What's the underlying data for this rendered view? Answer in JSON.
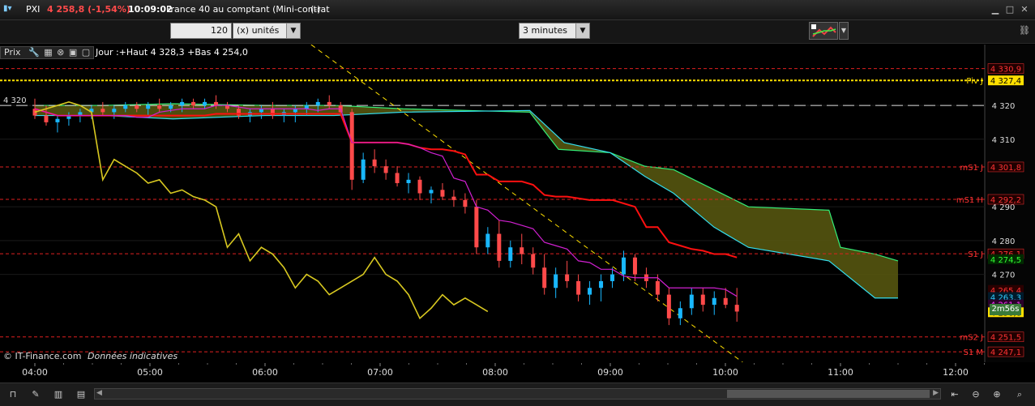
{
  "titlebar": {
    "symbol": "PXI",
    "price_change": "4 258,8 (-1,54%)",
    "time": "10:09:02",
    "name": "France 40 au comptant (Mini-contrat",
    "flag": "(-)",
    "colors": {
      "down": "#ff4a4a"
    }
  },
  "toolbar": {
    "units_value": "120",
    "units_label": "(x) unités",
    "interval": "3 minutes"
  },
  "panel": {
    "label": "Prix",
    "info": "Jour :+Haut 4 328,3 +Bas 4 254,0",
    "watermark": "© IT-Finance.com",
    "watermark_note": "Données indicatives",
    "timer": "2m56s"
  },
  "chart_data": {
    "type": "candlestick",
    "x_ticks": [
      "04:00",
      "05:00",
      "06:00",
      "07:00",
      "08:00",
      "09:00",
      "10:00",
      "11:00",
      "12:00"
    ],
    "y_ticks": [
      "4 320",
      "4 310",
      "4 290",
      "4 280",
      "4 270"
    ],
    "y_left_label": "4 320",
    "ylim": [
      4244,
      4338
    ],
    "levels": [
      {
        "name": "Piv J",
        "value": 4327.4,
        "label": "4 327,4",
        "color": "#ffe000",
        "style": "dotted-bold",
        "box": "#ffe000",
        "text_color": "#000"
      },
      {
        "name": "",
        "value": 4330.9,
        "label": "4 330,9",
        "color": "#e02020",
        "style": "dashed",
        "box": "#200000",
        "text_color": "#ff3333"
      },
      {
        "name": "mS1 J",
        "value": 4301.8,
        "label": "4 301,8",
        "color": "#e02020",
        "style": "dashed",
        "box": "#200000",
        "text_color": "#ff3333"
      },
      {
        "name": "mS1 H",
        "value": 4292.2,
        "label": "4 292,2",
        "color": "#e02020",
        "style": "dashed",
        "box": "#200000",
        "text_color": "#ff3333"
      },
      {
        "name": "S1 J",
        "value": 4276.1,
        "label": "4 276,1",
        "color": "#e02020",
        "style": "dashed",
        "box": "#200000",
        "text_color": "#ff3333"
      },
      {
        "name": "mS2 J",
        "value": 4251.5,
        "label": "4 251,5",
        "color": "#e02020",
        "style": "dashed",
        "box": "#200000",
        "text_color": "#ff3333"
      },
      {
        "name": "S1 M",
        "value": 4247.1,
        "label": "4 247,1",
        "color": "#e02020",
        "style": "dashed",
        "box": "#200000",
        "text_color": "#ff3333"
      },
      {
        "name": "",
        "value": 4320.0,
        "label": "",
        "color": "#dddddd",
        "style": "long-dash",
        "box": "",
        "text_color": ""
      }
    ],
    "price_boxes": [
      {
        "value": 4274.5,
        "label": "4 274,5",
        "bg": "#002a00",
        "color": "#33ff33"
      },
      {
        "value": 4265.4,
        "label": "4 265,4",
        "bg": "#2a0000",
        "color": "#ff3333"
      },
      {
        "value": 4263.3,
        "label": "4 263,3",
        "bg": "#001a2a",
        "color": "#33ccff"
      },
      {
        "value": 4261.1,
        "label": "4 261,1",
        "bg": "#2a002a",
        "color": "#ff33ff"
      },
      {
        "value": 4258.8,
        "label": "4 258,8",
        "bg": "#ffe000",
        "color": "#000000"
      }
    ],
    "candles": [
      [
        4319,
        4322,
        4316,
        4317
      ],
      [
        4317,
        4320,
        4314,
        4315
      ],
      [
        4315,
        4317,
        4312,
        4316
      ],
      [
        4316,
        4318,
        4314,
        4317
      ],
      [
        4317,
        4319,
        4315,
        4318
      ],
      [
        4318,
        4320,
        4316,
        4319
      ],
      [
        4319,
        4321,
        4317,
        4318
      ],
      [
        4318,
        4320,
        4316,
        4319
      ],
      [
        4319,
        4321,
        4318,
        4320
      ],
      [
        4320,
        4321,
        4318,
        4319
      ],
      [
        4319,
        4321,
        4317,
        4320
      ],
      [
        4320,
        4322,
        4318,
        4319
      ],
      [
        4319,
        4321,
        4318,
        4320
      ],
      [
        4320,
        4322,
        4318,
        4321
      ],
      [
        4321,
        4322,
        4319,
        4320
      ],
      [
        4320,
        4322,
        4319,
        4321
      ],
      [
        4321,
        4323,
        4319,
        4320
      ],
      [
        4320,
        4321,
        4318,
        4319
      ],
      [
        4319,
        4320,
        4316,
        4317
      ],
      [
        4317,
        4319,
        4315,
        4318
      ],
      [
        4318,
        4320,
        4316,
        4319
      ],
      [
        4319,
        4321,
        4316,
        4317
      ],
      [
        4317,
        4319,
        4315,
        4318
      ],
      [
        4318,
        4320,
        4315,
        4319
      ],
      [
        4319,
        4321,
        4317,
        4320
      ],
      [
        4320,
        4322,
        4318,
        4321
      ],
      [
        4321,
        4323,
        4319,
        4320
      ],
      [
        4320,
        4321,
        4317,
        4318
      ],
      [
        4318,
        4319,
        4295,
        4298
      ],
      [
        4298,
        4306,
        4297,
        4304
      ],
      [
        4304,
        4307,
        4300,
        4302
      ],
      [
        4302,
        4304,
        4298,
        4300
      ],
      [
        4300,
        4302,
        4296,
        4297
      ],
      [
        4297,
        4300,
        4294,
        4298
      ],
      [
        4298,
        4299,
        4292,
        4294
      ],
      [
        4294,
        4296,
        4291,
        4295
      ],
      [
        4295,
        4297,
        4292,
        4293
      ],
      [
        4293,
        4295,
        4290,
        4292
      ],
      [
        4292,
        4294,
        4288,
        4290
      ],
      [
        4290,
        4292,
        4276,
        4278
      ],
      [
        4278,
        4284,
        4276,
        4282
      ],
      [
        4282,
        4286,
        4272,
        4274
      ],
      [
        4274,
        4280,
        4272,
        4278
      ],
      [
        4278,
        4282,
        4273,
        4276
      ],
      [
        4276,
        4278,
        4270,
        4272
      ],
      [
        4272,
        4276,
        4264,
        4266
      ],
      [
        4266,
        4272,
        4263,
        4270
      ],
      [
        4270,
        4274,
        4266,
        4268
      ],
      [
        4268,
        4270,
        4262,
        4264
      ],
      [
        4264,
        4268,
        4261,
        4266
      ],
      [
        4266,
        4270,
        4262,
        4268
      ],
      [
        4268,
        4272,
        4266,
        4270
      ],
      [
        4270,
        4277,
        4268,
        4275
      ],
      [
        4275,
        4276,
        4268,
        4270
      ],
      [
        4270,
        4272,
        4266,
        4268
      ],
      [
        4268,
        4270,
        4262,
        4264
      ],
      [
        4264,
        4266,
        4255,
        4257
      ],
      [
        4257,
        4262,
        4255,
        4260
      ],
      [
        4260,
        4266,
        4258,
        4264
      ],
      [
        4264,
        4266,
        4259,
        4261
      ],
      [
        4261,
        4265,
        4258,
        4263
      ],
      [
        4263,
        4266,
        4260,
        4261
      ],
      [
        4261,
        4266,
        4256,
        4259
      ]
    ],
    "title": "",
    "xlabel": "",
    "ylabel": "",
    "colors": {
      "up": "#19b8ff",
      "down": "#ff4a4a",
      "kijun": "#ff1010",
      "tenkan": "#d020d0",
      "chikou": "#d8c820",
      "cloud_up": "#5a5a10",
      "cloud_edge_a": "#33ee77",
      "cloud_edge_b": "#33ddee",
      "trend": "#ffe000"
    }
  }
}
